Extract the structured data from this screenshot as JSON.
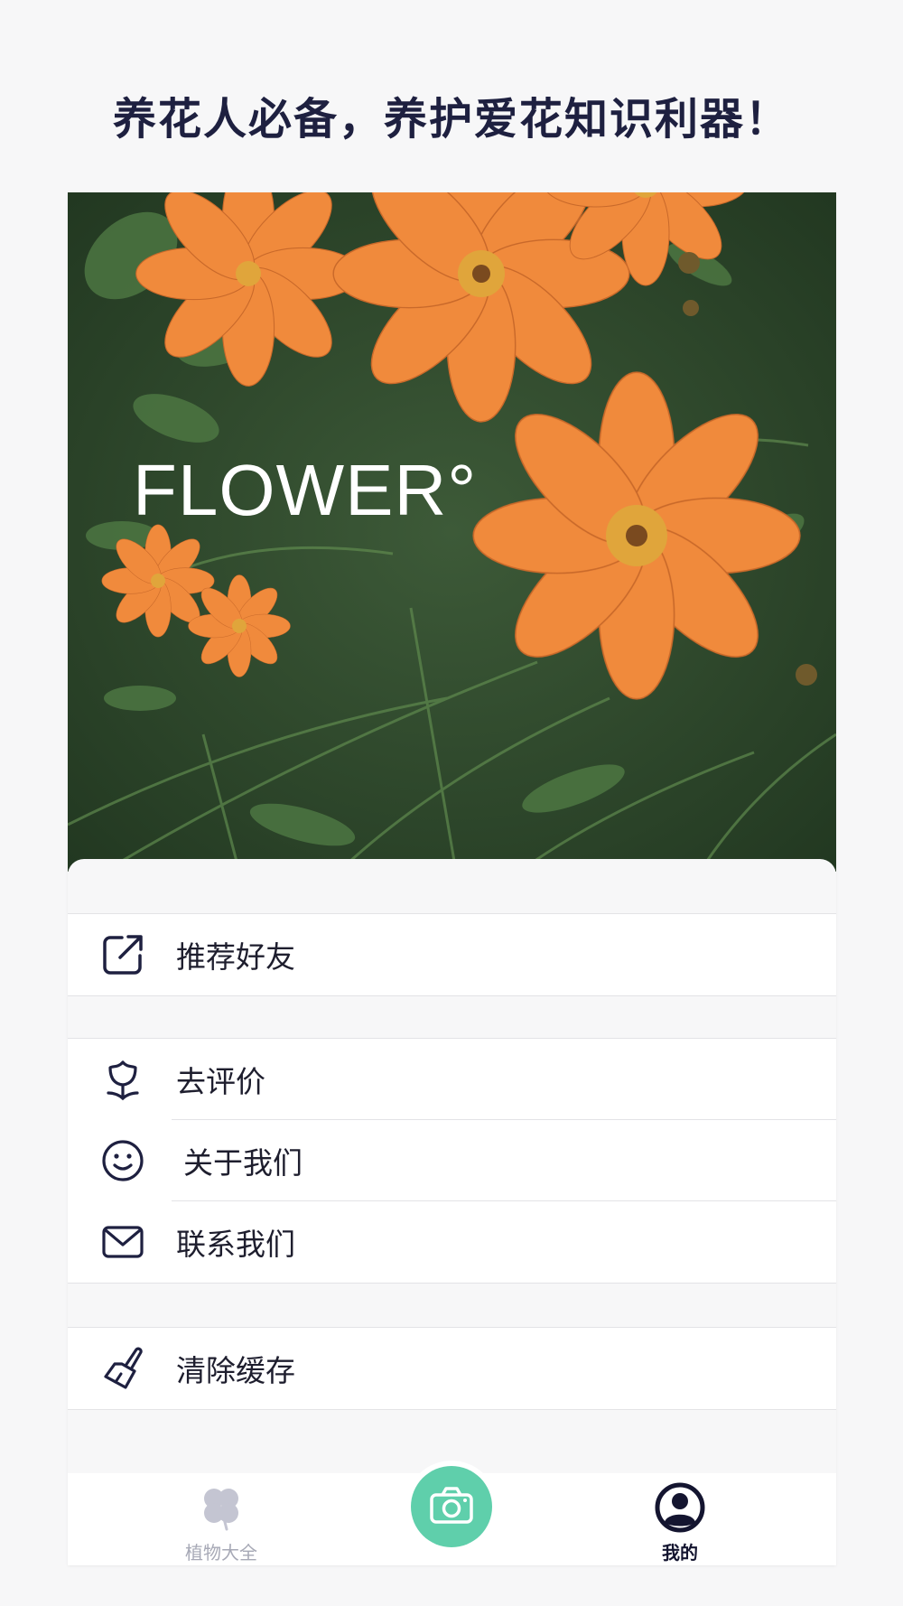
{
  "headline": "养花人必备，养护爱花知识利器！",
  "hero": {
    "wordmark": "FLOWER°"
  },
  "menu": {
    "group1": [
      {
        "label": "推荐好友",
        "icon": "share-icon"
      }
    ],
    "group2": [
      {
        "label": "去评价",
        "icon": "tulip-icon"
      },
      {
        "label": "关于我们",
        "icon": "smile-icon"
      },
      {
        "label": "联系我们",
        "icon": "mail-icon"
      }
    ],
    "group3": [
      {
        "label": "清除缓存",
        "icon": "broom-icon"
      }
    ]
  },
  "tabbar": {
    "tabs": [
      {
        "label": "植物大全",
        "icon": "clover-icon",
        "active": false
      },
      {
        "label": "",
        "icon": "camera-icon",
        "active": false
      },
      {
        "label": "我的",
        "icon": "user-icon",
        "active": true
      }
    ]
  },
  "colors": {
    "accent": "#5fcfab",
    "text": "#1e2040",
    "inactive": "#a7a9b6",
    "petal": "#f08a3c"
  }
}
